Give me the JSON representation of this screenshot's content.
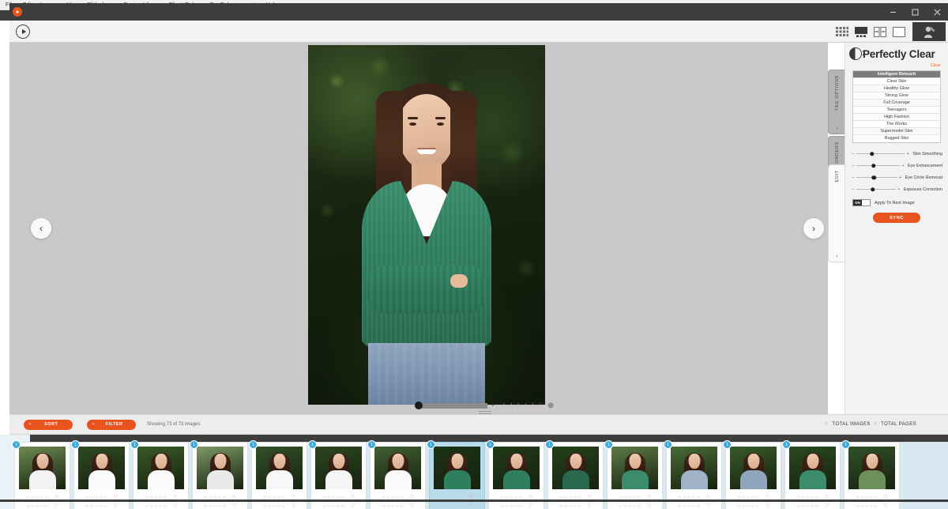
{
  "menu": {
    "items": [
      "File",
      "Edit",
      "Images",
      "View",
      "Slideshows",
      "Design Library",
      "Client Orders",
      "Pro Enhancements",
      "Help"
    ]
  },
  "window": {
    "minimize_label": "—",
    "maximize_label": "□",
    "close_label": "✕"
  },
  "toolbar": {
    "play_label": "play-slideshow",
    "view_modes": [
      {
        "name": "grid-view",
        "label": "Grid"
      },
      {
        "name": "filmstrip-view",
        "label": "Filmstrip"
      },
      {
        "name": "compare-view",
        "label": "Compare"
      },
      {
        "name": "single-view",
        "label": "Single"
      }
    ],
    "retouch_label": "Retouch"
  },
  "canvas": {
    "prev_label": "‹",
    "next_label": "›",
    "zoom_value": 0,
    "zoom_plus": "+",
    "stars": [
      "☆",
      "☆",
      "☆",
      "☆",
      "☆"
    ],
    "heart": "♡",
    "target": "⊕"
  },
  "vtabs": [
    {
      "label": "TAG OPTIONS",
      "caret": "›",
      "active": false
    },
    {
      "label": "ORDERS",
      "caret": "›",
      "active": false
    },
    {
      "label": "EDIT",
      "caret": "›",
      "active": true
    }
  ],
  "panel": {
    "brand": "Perfectly Clear",
    "clear_link": "Clear",
    "presets": [
      "Intelligent Retouch",
      "Clear Skin",
      "Healthy Glow",
      "Strong Glow",
      "Full Coverage",
      "Teenagers",
      "High Fashion",
      "The Works",
      "Supermodel Skin",
      "Rugged Skin"
    ],
    "selected_preset": "Intelligent Retouch",
    "sliders": [
      {
        "label": "Skin Smoothing",
        "minus": "–",
        "plus": "+",
        "value": 32
      },
      {
        "label": "Eye Enhancement",
        "minus": "–",
        "plus": "+",
        "value": 40
      },
      {
        "label": "Eye Circle Removal",
        "minus": "–",
        "plus": "+",
        "value": 43
      },
      {
        "label": "Exposure Correction",
        "minus": "–",
        "plus": "+",
        "value": 42
      }
    ],
    "toggle": {
      "state": "ON",
      "label": "Apply To Next Image"
    },
    "sync_label": "SYNC",
    "accent_color": "#e8541e"
  },
  "statusbar": {
    "sort_label": "SORT",
    "filter_label": "FILTER",
    "caret": "‹",
    "showing": "Showing 73 of 73 images",
    "total_images": {
      "count": "0",
      "label": "TOTAL IMAGES"
    },
    "total_pages": {
      "count": "0",
      "label": "TOTAL PAGES"
    }
  },
  "filmstrip": {
    "badge_value": "1",
    "stars": [
      "☆",
      "☆",
      "☆",
      "☆",
      "☆"
    ],
    "heart": "♡",
    "thumbnails": [
      {
        "badge": "1",
        "selected": false,
        "top": "#6d8a52",
        "garment": "#f2f2f2"
      },
      {
        "badge": "1",
        "selected": false,
        "top": "#2f4a22",
        "garment": "#fbfbfb"
      },
      {
        "badge": "1",
        "selected": false,
        "top": "#3a5a28",
        "garment": "#fafafa"
      },
      {
        "badge": "1",
        "selected": false,
        "top": "#7c9a64",
        "garment": "#e9e9ea"
      },
      {
        "badge": "1",
        "selected": false,
        "top": "#33502a",
        "garment": "#f7f7f7"
      },
      {
        "badge": "1",
        "selected": false,
        "top": "#2c4620",
        "garment": "#f5f5f5"
      },
      {
        "badge": "1",
        "selected": false,
        "top": "#415f32",
        "garment": "#fafafa"
      },
      {
        "badge": "1",
        "selected": true,
        "top": "#1c3315",
        "garment": "#2f7f5f"
      },
      {
        "badge": "1",
        "selected": false,
        "top": "#203a18",
        "garment": "#2f7f5f"
      },
      {
        "badge": "1",
        "selected": false,
        "top": "#24411c",
        "garment": "#27684e"
      },
      {
        "badge": "1",
        "selected": false,
        "top": "#5d7c46",
        "garment": "#3a8c6c"
      },
      {
        "badge": "1",
        "selected": false,
        "top": "#4a6b38",
        "garment": "#9fb2c6"
      },
      {
        "badge": "1",
        "selected": false,
        "top": "#395a2b",
        "garment": "#8fa4bd"
      },
      {
        "badge": "1",
        "selected": false,
        "top": "#2a4a20",
        "garment": "#3a8c6c"
      },
      {
        "badge": "1",
        "selected": false,
        "top": "#31512a",
        "garment": "#6f8f58"
      }
    ]
  }
}
